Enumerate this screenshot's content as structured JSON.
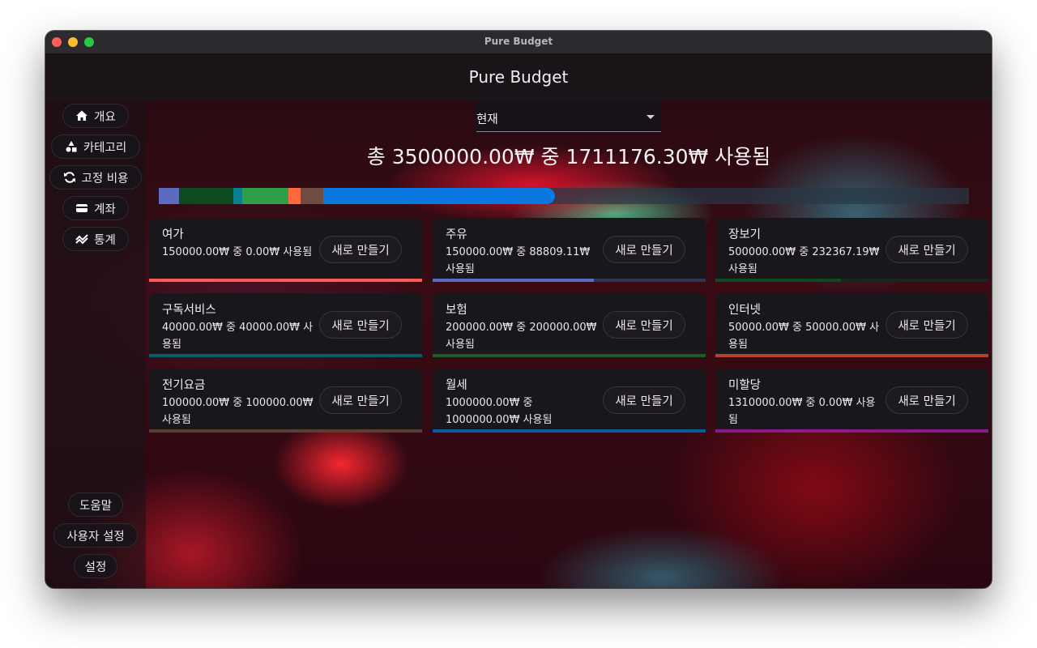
{
  "window": {
    "title": "Pure Budget"
  },
  "appbar": {
    "title": "Pure Budget"
  },
  "sidebar": {
    "top_items": [
      {
        "label": "개요",
        "icon": "home-icon"
      },
      {
        "label": "카테고리",
        "icon": "shapes-icon"
      },
      {
        "label": "고정 비용",
        "icon": "repeat-icon"
      },
      {
        "label": "계좌",
        "icon": "wallet-icon"
      },
      {
        "label": "통계",
        "icon": "chart-icon"
      }
    ],
    "bottom_items": [
      {
        "label": "도움말"
      },
      {
        "label": "사용자 설정"
      },
      {
        "label": "설정"
      }
    ]
  },
  "period_select": {
    "value": "현재"
  },
  "summary": {
    "text": "총 3500000.00₩ 중 1711176.30₩ 사용됨"
  },
  "budget_bar": {
    "total": 3500000,
    "segments": [
      {
        "name": "주유",
        "value": 88809.11,
        "color": "#5c6bc0"
      },
      {
        "name": "장보기",
        "value": 232367.19,
        "color": "#0d4a1f"
      },
      {
        "name": "구독서비스",
        "value": 40000,
        "color": "#0a7f8f"
      },
      {
        "name": "보험",
        "value": 200000,
        "color": "#2e9e48"
      },
      {
        "name": "인터넷",
        "value": 50000,
        "color": "#ff6a3d"
      },
      {
        "name": "전기요금",
        "value": 100000,
        "color": "#6d4c41"
      },
      {
        "name": "월세",
        "value": 1000000,
        "color": "#0a78e0"
      }
    ]
  },
  "new_button_label": "새로 만들기",
  "categories": [
    {
      "name": "여가",
      "usage": "150000.00₩ 중 0.00₩ 사용됨",
      "progress": 1.0,
      "color": "#ff5a52"
    },
    {
      "name": "주유",
      "usage": "150000.00₩ 중 88809.11₩ 사용됨",
      "progress": 0.59,
      "color": "#5c6bc0"
    },
    {
      "name": "장보기",
      "usage": "500000.00₩ 중 232367.19₩ 사용됨",
      "progress": 0.46,
      "color": "#0d4a1f"
    },
    {
      "name": "구독서비스",
      "usage": "40000.00₩ 중 40000.00₩ 사용됨",
      "progress": 1.0,
      "color": "#0a5f6a"
    },
    {
      "name": "보험",
      "usage": "200000.00₩ 중 200000.00₩ 사용됨",
      "progress": 1.0,
      "color": "#1f5a2a"
    },
    {
      "name": "인터넷",
      "usage": "50000.00₩ 중 50000.00₩ 사용됨",
      "progress": 1.0,
      "color": "#b5432a"
    },
    {
      "name": "전기요금",
      "usage": "100000.00₩ 중 100000.00₩ 사용됨",
      "progress": 1.0,
      "color": "#5a3f30"
    },
    {
      "name": "월세",
      "usage": "1000000.00₩ 중 1000000.00₩ 사용됨",
      "progress": 1.0,
      "color": "#0a5b9a"
    },
    {
      "name": "미할당",
      "usage": "1310000.00₩ 중 0.00₩ 사용됨",
      "progress": 1.0,
      "color": "#8a1a8c"
    }
  ]
}
